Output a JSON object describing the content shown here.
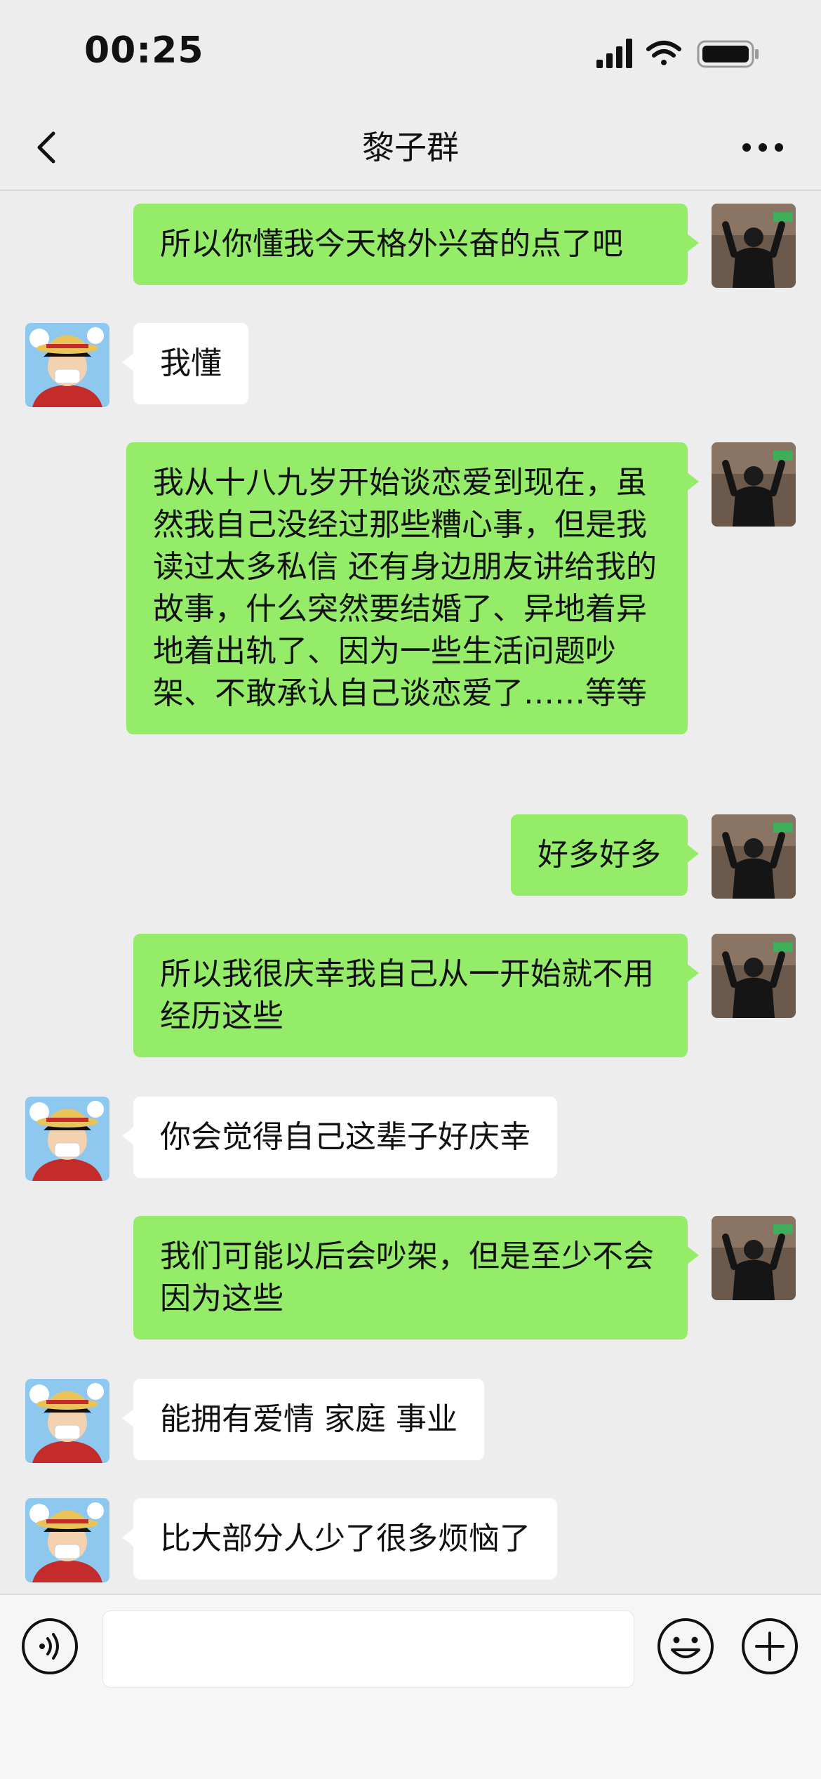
{
  "status_bar": {
    "time": "00:25"
  },
  "header": {
    "title": "黎子群"
  },
  "messages": [
    {
      "side": "me",
      "text": "所以你懂我今天格外兴奋的点了吧"
    },
    {
      "side": "other",
      "text": "我懂"
    },
    {
      "side": "me",
      "text": "我从十八九岁开始谈恋爱到现在，虽然我自己没经过那些糟心事，但是我读过太多私信 还有身边朋友讲给我的故事，什么突然要结婚了、异地着异地着出轨了、因为一些生活问题吵架、不敢承认自己谈恋爱了……等等"
    },
    {
      "side": "me",
      "text": "好多好多"
    },
    {
      "side": "me",
      "text": "所以我很庆幸我自己从一开始就不用经历这些"
    },
    {
      "side": "other",
      "text": "你会觉得自己这辈子好庆幸"
    },
    {
      "side": "me",
      "text": "我们可能以后会吵架，但是至少不会因为这些"
    },
    {
      "side": "other",
      "text": "能拥有爱情 家庭 事业"
    },
    {
      "side": "other",
      "text": "比大部分人少了很多烦恼了"
    }
  ],
  "input": {
    "value": ""
  },
  "icons": {
    "status": [
      "signal-icon",
      "wifi-icon",
      "battery-icon"
    ],
    "header": [
      "back-arrow-icon",
      "more-icon"
    ],
    "input": [
      "voice-icon",
      "emoji-icon",
      "plus-icon"
    ]
  },
  "colors": {
    "my_bubble": "#95ec69",
    "their_bubble": "#ffffff",
    "background": "#ededed"
  }
}
